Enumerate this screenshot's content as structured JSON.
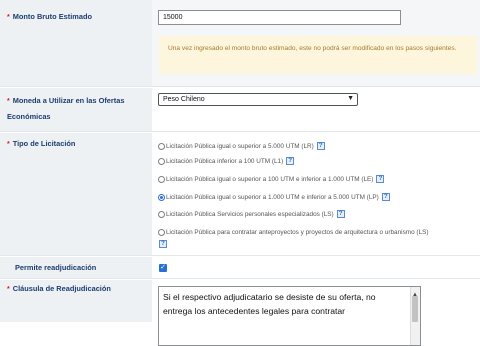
{
  "monto": {
    "label": "Monto Bruto Estimado",
    "value": "15000",
    "notice": "Una vez ingresado el monto bruto estimado, este no podrá ser modificado en los pasos siguientes."
  },
  "moneda": {
    "label": "Moneda a Utilizar en las Ofertas Económicas",
    "selected": "Peso Chileno",
    "chevron": "▼"
  },
  "tipo": {
    "label": "Tipo de Licitación",
    "options": [
      {
        "label": "Licitación Pública igual o superior a 5.000 UTM (LR)",
        "checked": false
      },
      {
        "label": "Licitación Pública inferior a 100 UTM (L1)",
        "checked": false
      },
      {
        "label": "Licitación Pública igual o superior a 100 UTM e inferior a 1.000 UTM (LE)",
        "checked": false
      },
      {
        "label": "Licitación Pública igual o superior a 1.000 UTM e inferior a 5.000 UTM (LP)",
        "checked": true
      },
      {
        "label": "Licitación Pública Servicios personales especializados (LS)",
        "checked": false
      },
      {
        "label": "Licitación Pública para contratar anteproyectos y proyectos de arquitectura o urbanismo (LS)",
        "checked": false
      }
    ],
    "help_glyph": "?"
  },
  "readjudicacion": {
    "label": "Permite readjudicación",
    "checked": true,
    "check_glyph": "✓"
  },
  "clausula": {
    "label": "Cláusula de Readjudicación",
    "text": "Si el respectivo adjudicatario se desiste de su oferta, no entrega los antecedentes legales para contratar",
    "scroll_up_glyph": "▲"
  },
  "required_marker": "*",
  "colors": {
    "label_text": "#1d3d6f",
    "required": "#d3192c",
    "label_bg": "#eef1f4",
    "notice_bg": "#fdf6dc",
    "notice_text": "#a87933",
    "accent": "#2a6fd6"
  }
}
